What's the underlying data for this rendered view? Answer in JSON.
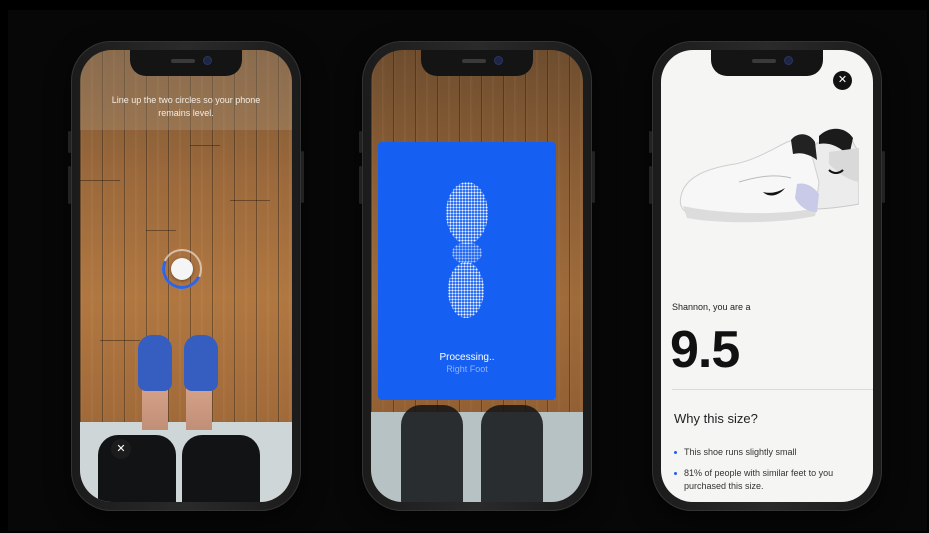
{
  "screen1": {
    "instruction": "Line up the two circles so your phone remains level.",
    "close_glyph": "✕"
  },
  "screen2": {
    "status_title": "Processing..",
    "status_subtitle": "Right Foot",
    "card_color": "#1560f2"
  },
  "screen3": {
    "close_glyph": "✕",
    "size_intro": "Shannon, you are a",
    "size_value": "9.5",
    "why_title": "Why this size?",
    "reasons": [
      "This shoe runs slightly small",
      "81% of people with similar feet to you purchased this size."
    ],
    "accent_color": "#1d60ef"
  },
  "icons": {
    "close": "close-icon",
    "level": "level-circle-icon",
    "shoe": "sneaker-image"
  }
}
